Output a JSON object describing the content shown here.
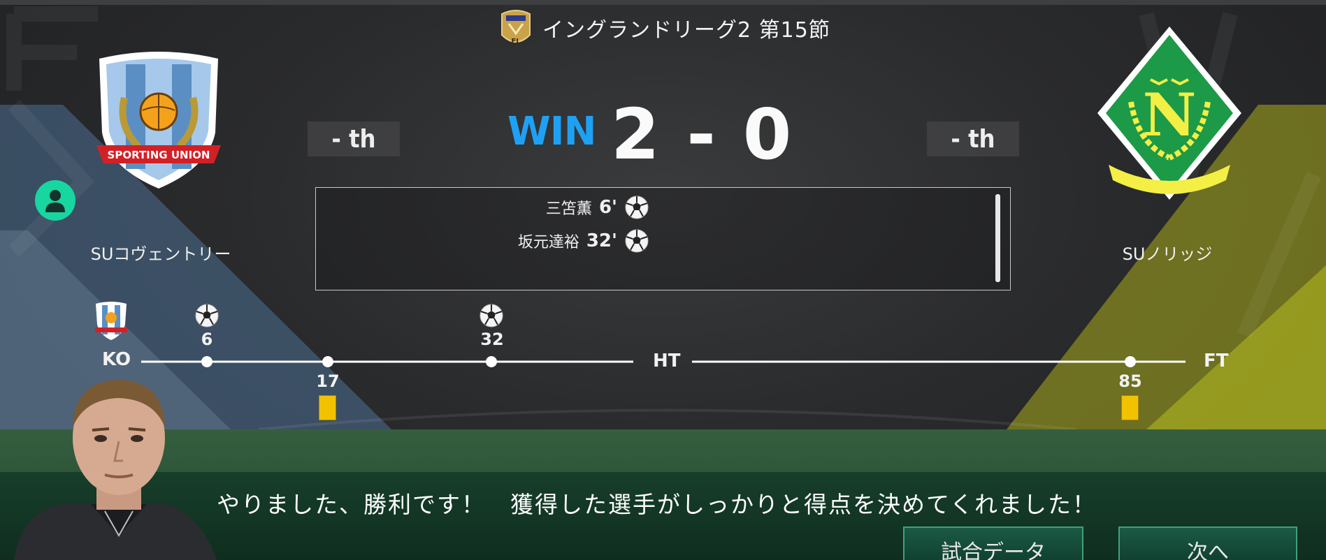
{
  "league": {
    "title": "イングランドリーグ2 第15節",
    "logo_text": "FL"
  },
  "home": {
    "name": "SUコヴェントリー",
    "rank": "- th",
    "crest_text": "SPORTING UNION"
  },
  "away": {
    "name": "SUノリッジ",
    "rank": "- th",
    "crest_letter": "N",
    "crest_text": "S.U.N."
  },
  "match": {
    "result": "WIN",
    "score": "2 - 0"
  },
  "goals": [
    {
      "player": "三笘薫",
      "minute": "6'",
      "icon": "soccer-ball-icon"
    },
    {
      "player": "坂元達裕",
      "minute": "32'",
      "icon": "soccer-ball-icon"
    }
  ],
  "timeline": {
    "start": "KO",
    "half": "HT",
    "end": "FT",
    "events": [
      {
        "minute": "6",
        "type": "goal",
        "side": "home"
      },
      {
        "minute": "17",
        "type": "yellow-card",
        "side": "home"
      },
      {
        "minute": "32",
        "type": "goal",
        "side": "home"
      },
      {
        "minute": "85",
        "type": "yellow-card",
        "side": "away"
      }
    ]
  },
  "message": "やりました、勝利です！　獲得した選手がしっかりと得点を決めてくれました！",
  "buttons": {
    "match_data": "試合データ",
    "next": "次へ"
  },
  "colors": {
    "win": "#1ea1f4",
    "avatar": "#17d6a0",
    "yellow_card": "#f2c200",
    "home_band": "#5a86b4",
    "away_band": "#c8c800"
  }
}
